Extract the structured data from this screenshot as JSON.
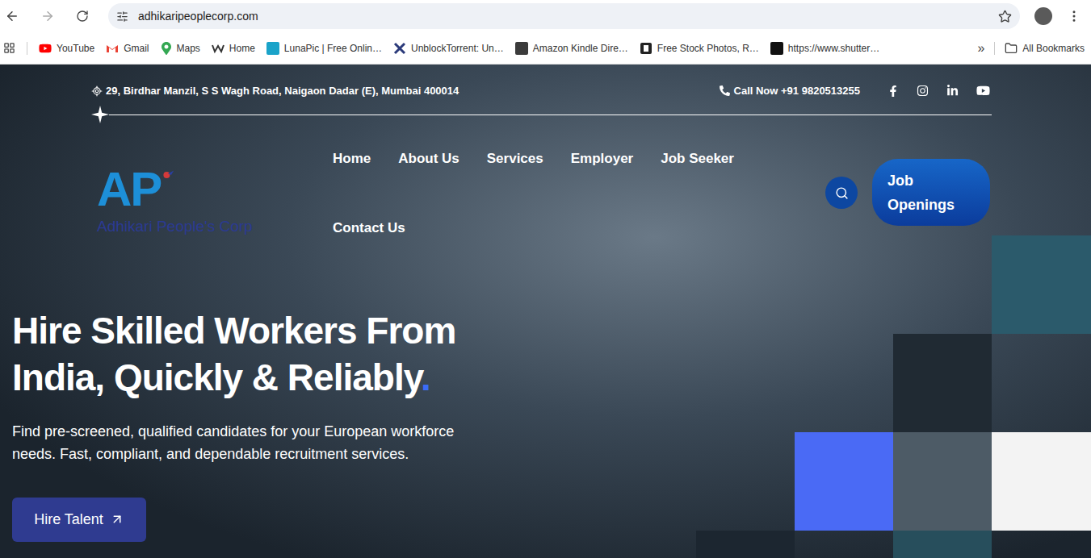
{
  "browser": {
    "url": "adhikaripeoplecorp.com",
    "bookmarks": [
      {
        "label": "YouTube",
        "kind": "youtube"
      },
      {
        "label": "Gmail",
        "kind": "gmail"
      },
      {
        "label": "Maps",
        "kind": "maps"
      },
      {
        "label": "Home",
        "kind": "wix"
      },
      {
        "label": "LunaPic | Free Onlin…",
        "kind": "lunapic"
      },
      {
        "label": "UnblockTorrent: Un…",
        "kind": "torrent"
      },
      {
        "label": "Amazon Kindle Dire…",
        "kind": "kindle"
      },
      {
        "label": "Free Stock Photos, R…",
        "kind": "stock"
      },
      {
        "label": "https://www.shutter…",
        "kind": "shutter"
      }
    ],
    "overflow": "»",
    "all_bookmarks": "All Bookmarks"
  },
  "topbar": {
    "address": "29, Birdhar Manzil, S S Wagh Road, Naigaon Dadar (E), Mumbai 400014",
    "phone": "Call Now +91 9820513255"
  },
  "logo": {
    "mark": "AP",
    "name": "Adhikari People's Corp"
  },
  "nav": {
    "items": [
      {
        "label": "Home"
      },
      {
        "label": "About Us"
      },
      {
        "label": "Services"
      },
      {
        "label": "Employer"
      },
      {
        "label": "Job Seeker"
      },
      {
        "label": "Contact Us"
      }
    ],
    "cta": "Job Openings"
  },
  "hero": {
    "lines": [
      "Hire Skilled Workers From",
      "India, Quickly & Reliably"
    ],
    "accent": ".",
    "subtitle_lines": [
      "Find pre-screened, qualified candidates for your European workforce",
      "needs. Fast, compliant, and dependable recruitment services."
    ],
    "button": "Hire Talent"
  }
}
